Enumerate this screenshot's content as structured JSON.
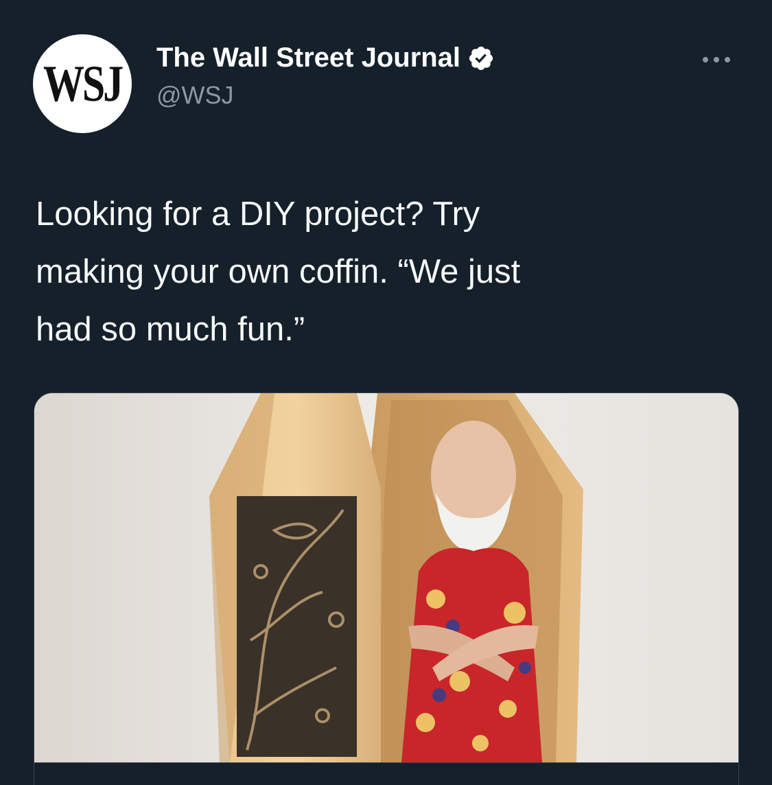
{
  "account": {
    "avatar_text": "WSJ",
    "display_name": "The Wall Street Journal",
    "handle": "@WSJ",
    "verified": true,
    "verified_icon": "verified-badge-icon",
    "more_icon": "more-options-icon"
  },
  "tweet": {
    "text": "Looking for a DIY project? Try\nmaking your own coffin. “We just\nhad so much fun.”"
  },
  "colors": {
    "background": "#15202b",
    "text": "#f7f9f9",
    "secondary_text": "#8b98a5",
    "border": "#38444d"
  }
}
